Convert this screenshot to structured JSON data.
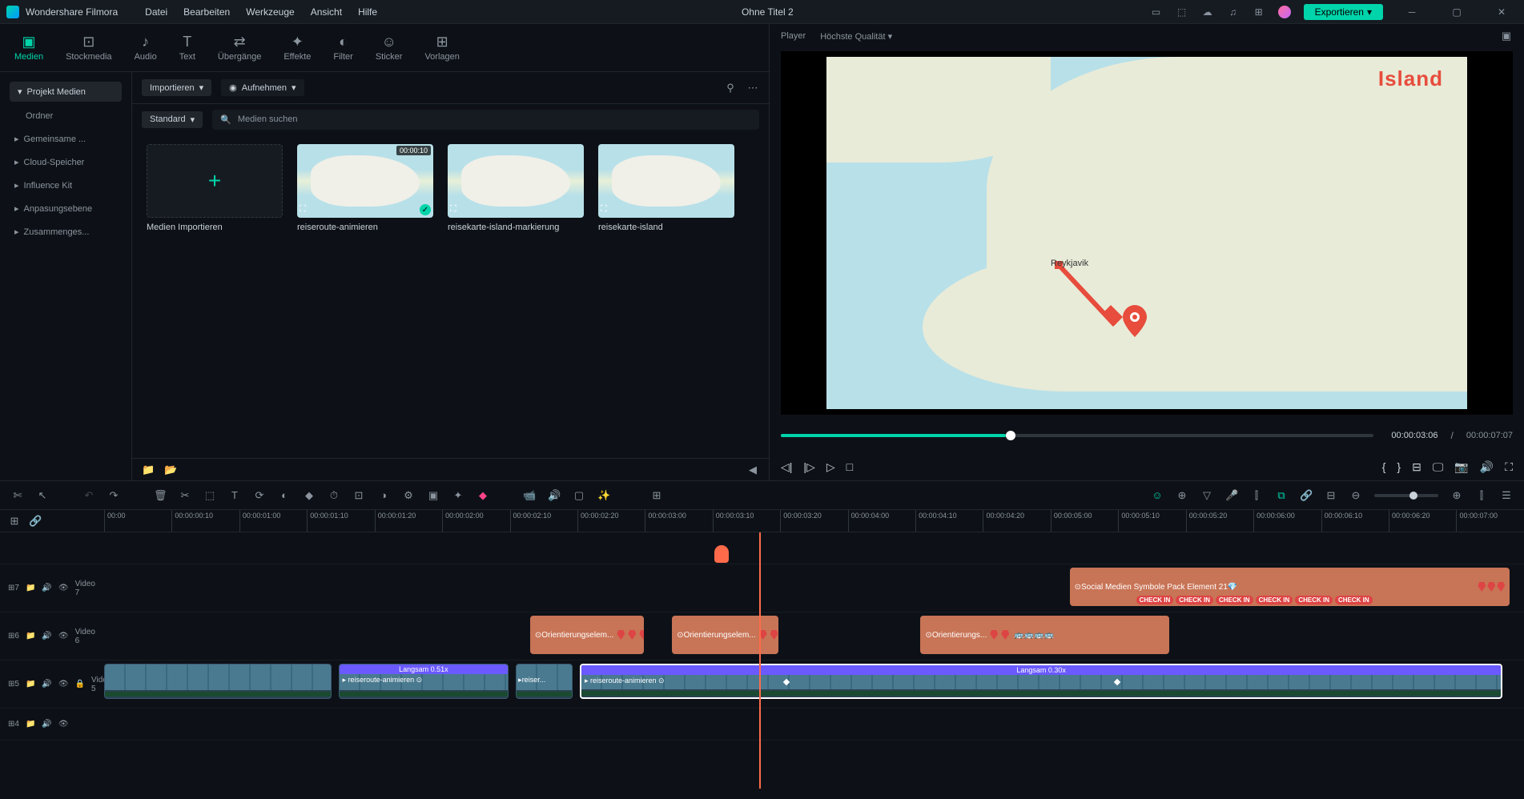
{
  "app": {
    "name": "Wondershare Filmora",
    "project_title": "Ohne Titel 2"
  },
  "menu": {
    "file": "Datei",
    "edit": "Bearbeiten",
    "tools": "Werkzeuge",
    "view": "Ansicht",
    "help": "Hilfe"
  },
  "export_button": "Exportieren",
  "top_tabs": {
    "media": "Medien",
    "stockmedia": "Stockmedia",
    "audio": "Audio",
    "text": "Text",
    "transitions": "Übergänge",
    "effects": "Effekte",
    "filter": "Filter",
    "sticker": "Sticker",
    "templates": "Vorlagen"
  },
  "sidebar": {
    "project_media": "Projekt Medien",
    "folder": "Ordner",
    "shared": "Gemeinsame ...",
    "cloud": "Cloud-Speicher",
    "influence": "Influence Kit",
    "adjustment": "Anpasungsebene",
    "compound": "Zusammenges..."
  },
  "media_bar": {
    "import": "Importieren",
    "record": "Aufnehmen",
    "view_mode": "Standard",
    "search_placeholder": "Medien suchen"
  },
  "media_items": {
    "import_label": "Medien Importieren",
    "clip1_label": "reiseroute-animieren",
    "clip1_duration": "00:00:10",
    "clip2_label": "reisekarte-island-markierung",
    "clip3_label": "reisekarte-island"
  },
  "player": {
    "tab": "Player",
    "quality": "Höchste Qualität",
    "map_label": "Island",
    "current_time": "00:00:03:06",
    "total_time": "00:00:07:07"
  },
  "timeline": {
    "ruler": [
      "00:00",
      "00:00:00:10",
      "00:00:01:00",
      "00:00:01:10",
      "00:00:01:20",
      "00:00:02:00",
      "00:00:02:10",
      "00:00:02:20",
      "00:00:03:00",
      "00:00:03:10",
      "00:00:03:20",
      "00:00:04:00",
      "00:00:04:10",
      "00:00:04:20",
      "00:00:05:00",
      "00:00:05:10",
      "00:00:05:20",
      "00:00:06:00",
      "00:00:06:10",
      "00:00:06:20",
      "00:00:07:00"
    ],
    "tracks": {
      "v7": "Video 7",
      "v6": "Video 6",
      "v5": "Video 5"
    },
    "clips": {
      "social_media": "Social Medien Symbole Pack Element 21",
      "checkin": "CHECK IN",
      "orient": "Orientierungselem...",
      "orient2": "Orientierungs...",
      "reiseroute": "reiseroute-animieren",
      "reiser_short": "reiser...",
      "speed1": "Langsam 0.51x",
      "speed2": "Langsam 0.30x"
    }
  }
}
